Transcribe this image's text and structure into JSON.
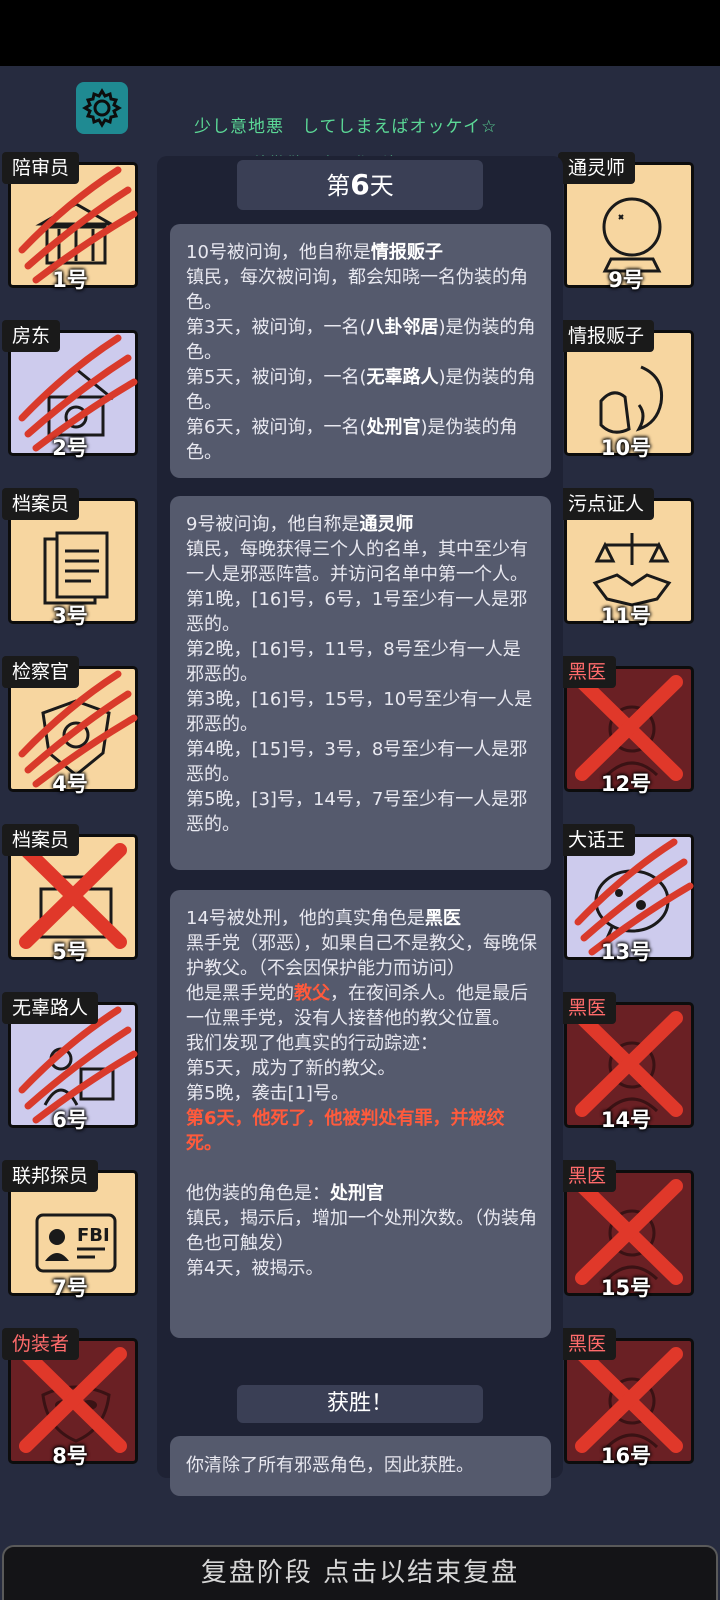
{
  "marquee": {
    "line1": "少し意地悪　してしまえばオッケイ☆",
    "line2": "稍微做一点恶作剧好了☆"
  },
  "day_title": {
    "prefix": "第",
    "day": "6",
    "suffix": "天"
  },
  "left_cards": [
    {
      "role": "陪审员",
      "number": "1号",
      "status": "clawed",
      "icon": "courthouse-icon"
    },
    {
      "role": "房东",
      "number": "2号",
      "status": "clawed",
      "icon": "house-icon"
    },
    {
      "role": "档案员",
      "number": "3号",
      "status": "alive",
      "icon": "documents-icon"
    },
    {
      "role": "检察官",
      "number": "4号",
      "status": "clawed",
      "icon": "badge-icon"
    },
    {
      "role": "档案员",
      "number": "5号",
      "status": "executed",
      "icon": "briefcase-icon"
    },
    {
      "role": "无辜路人",
      "number": "6号",
      "status": "clawed",
      "icon": "bystander-icon"
    },
    {
      "role": "联邦探员",
      "number": "7号",
      "status": "alive",
      "icon": "fbi-badge-icon"
    },
    {
      "role": "伪装者",
      "number": "8号",
      "status": "dead",
      "icon": "mask-icon"
    }
  ],
  "right_cards": [
    {
      "role": "通灵师",
      "number": "9号",
      "status": "alive",
      "icon": "crystal-ball-icon"
    },
    {
      "role": "情报贩子",
      "number": "10号",
      "status": "alive",
      "icon": "whisper-icon"
    },
    {
      "role": "污点证人",
      "number": "11号",
      "status": "alive",
      "icon": "scales-handshake-icon"
    },
    {
      "role": "黑医",
      "number": "12号",
      "status": "dead",
      "icon": "doctor-icon"
    },
    {
      "role": "大话王",
      "number": "13号",
      "status": "clawed",
      "icon": "speech-bubble-icon"
    },
    {
      "role": "黑医",
      "number": "14号",
      "status": "dead",
      "icon": "doctor-icon"
    },
    {
      "role": "黑医",
      "number": "15号",
      "status": "dead",
      "icon": "doctor-icon"
    },
    {
      "role": "黑医",
      "number": "16号",
      "status": "dead",
      "icon": "doctor-icon"
    }
  ],
  "box1": {
    "intro": "10号被问询，他自称是",
    "role": "情报贩子",
    "body": "镇民，每次被问询，都会知晓一名伪装的角色。\n第3天，被问询，一名(",
    "r1": "八卦邻居",
    "t2": ")是伪装的角色。\n第5天，被问询，一名(",
    "r2": "无辜路人",
    "t3": ")是伪装的角色。\n第6天，被问询，一名(",
    "r3": "处刑官",
    "t4": ")是伪装的角色。"
  },
  "box2": {
    "intro": "9号被问询，他自称是",
    "role": "通灵师",
    "body": "镇民，每晚获得三个人的名单，其中至少有一人是邪恶阵营。并访问名单中第一个人。\n第1晚，[16]号，6号，1号至少有一人是邪恶的。\n第2晚，[16]号，11号，8号至少有一人是邪恶的。\n第3晚，[16]号，15号，10号至少有一人是邪恶的。\n第4晚，[15]号，3号，8号至少有一人是邪恶的。\n第5晚，[3]号，14号，7号至少有一人是邪恶的。"
  },
  "box3": {
    "intro": "14号被处刑，他的真实角色是",
    "role": "黑医",
    "body1": "黑手党（邪恶），如果自己不是教父，每晚保护教父。（不会因保护能力而访问）\n他是黑手党的",
    "godfather": "教父",
    "body2": "，在夜间杀人。他是最后一位黑手党，没有人接替他的教父位置。\n我们发现了他真实的行动踪迹：\n第5天，成为了新的教父。\n第5晚，袭击[1]号。",
    "death": "第6天，他死了，他被判处有罪，并被绞死。",
    "disguise_intro": "他伪装的角色是：",
    "disguise_role": "处刑官",
    "body3": "镇民，揭示后，增加一个处刑次数。（伪装角色也可触发）\n第4天，被揭示。"
  },
  "win": {
    "title": "获胜！",
    "text": "你清除了所有邪恶角色，因此获胜。"
  },
  "bottom_bar": "复盘阶段 点击以结束复盘",
  "colors": {
    "background": "#262b3f",
    "card_alive": "#f7d6a0",
    "card_dead": "#6a2024",
    "card_lavender": "#cdcbed",
    "claw": "#d93a2b",
    "highlight": "#ff5a3c",
    "gear": "#1f8a92"
  }
}
